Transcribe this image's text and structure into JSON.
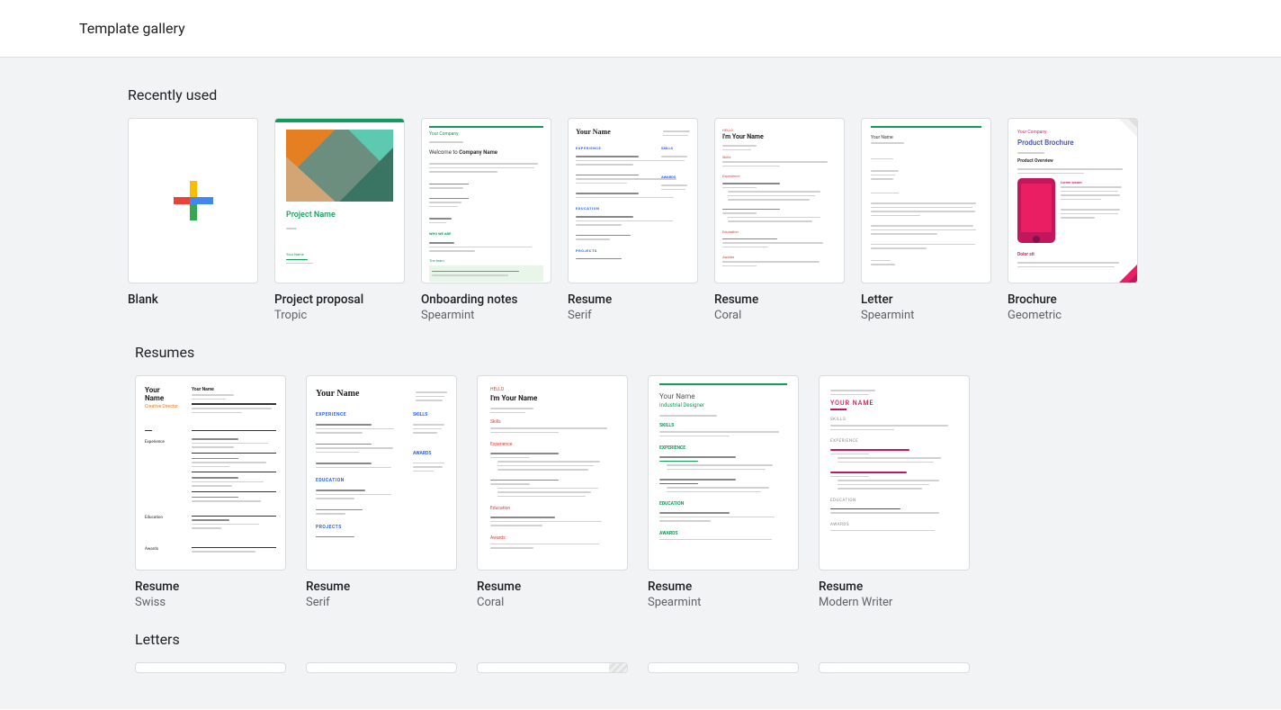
{
  "header": {
    "title": "Template gallery"
  },
  "sections": {
    "recent": {
      "title": "Recently used",
      "cards": [
        {
          "title": "Blank",
          "subtitle": ""
        },
        {
          "title": "Project proposal",
          "subtitle": "Tropic"
        },
        {
          "title": "Onboarding notes",
          "subtitle": "Spearmint"
        },
        {
          "title": "Resume",
          "subtitle": "Serif"
        },
        {
          "title": "Resume",
          "subtitle": "Coral"
        },
        {
          "title": "Letter",
          "subtitle": "Spearmint"
        },
        {
          "title": "Brochure",
          "subtitle": "Geometric"
        }
      ]
    },
    "resumes": {
      "title": "Resumes",
      "cards": [
        {
          "title": "Resume",
          "subtitle": "Swiss"
        },
        {
          "title": "Resume",
          "subtitle": "Serif"
        },
        {
          "title": "Resume",
          "subtitle": "Coral"
        },
        {
          "title": "Resume",
          "subtitle": "Spearmint"
        },
        {
          "title": "Resume",
          "subtitle": "Modern Writer"
        }
      ]
    },
    "letters": {
      "title": "Letters"
    }
  }
}
